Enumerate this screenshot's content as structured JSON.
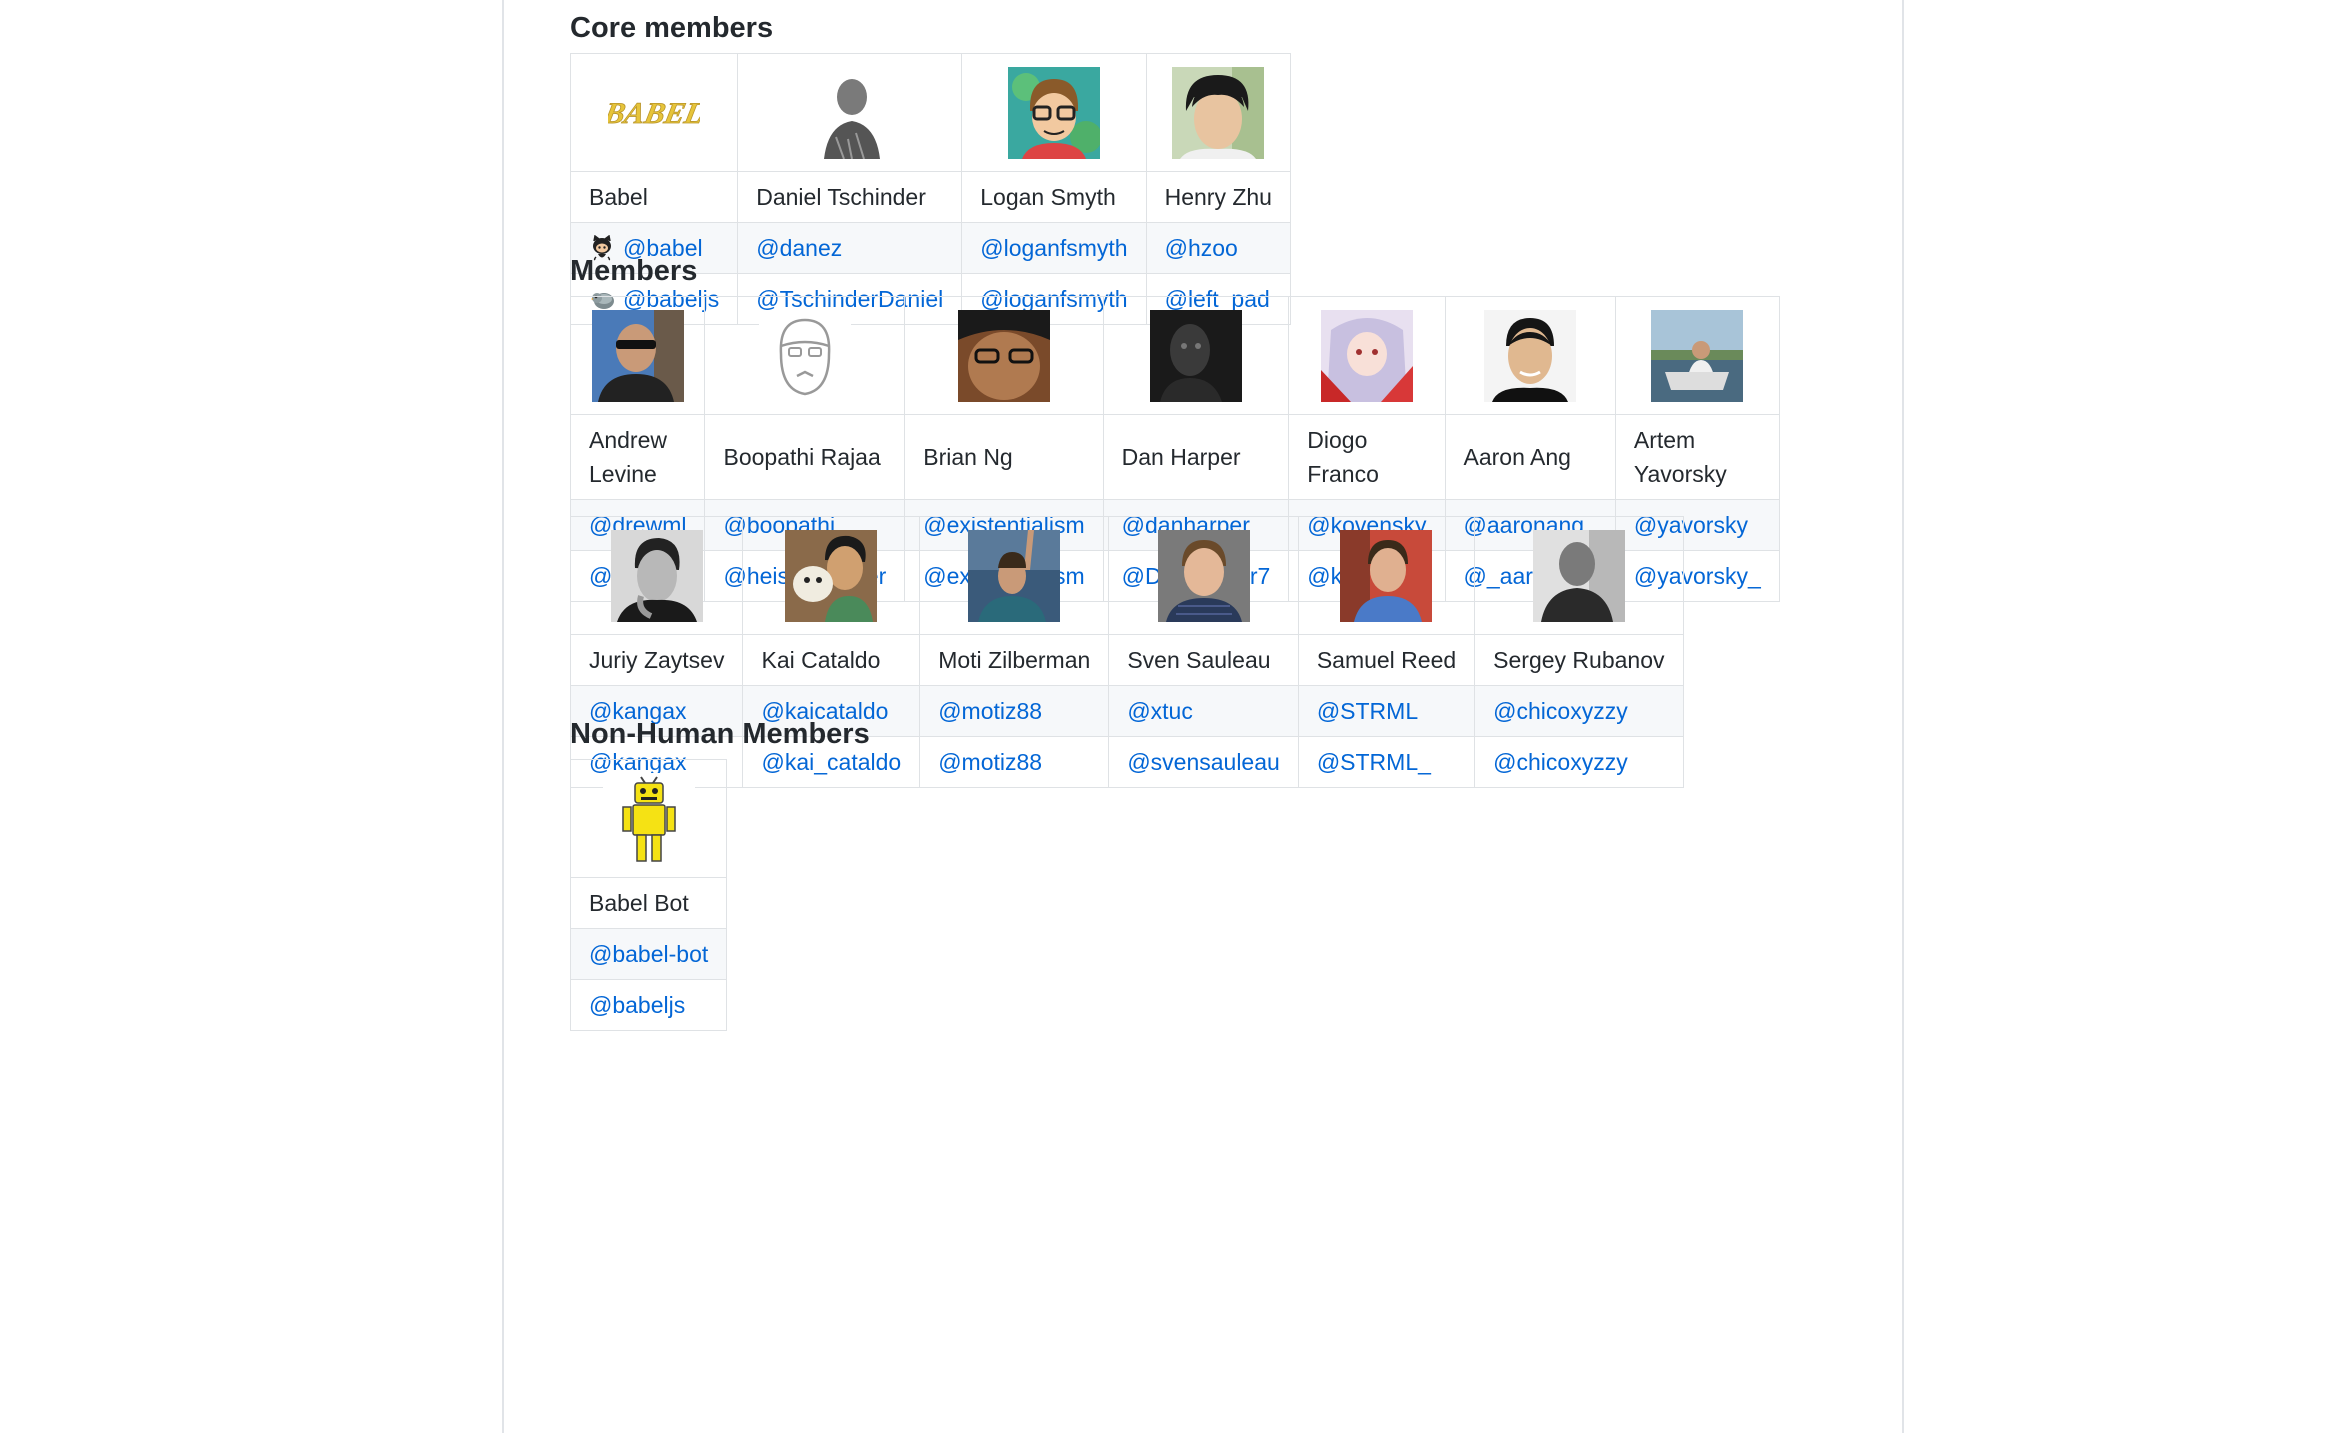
{
  "sections": {
    "core_title": "Core members",
    "members_title": "Members",
    "nonhuman_title": "Non-Human Members"
  },
  "core": [
    {
      "name": "Babel",
      "github": "@babel",
      "twitter": "@babeljs",
      "avatar": "babel-logo"
    },
    {
      "name": "Daniel Tschinder",
      "github": "@danez",
      "twitter": "@TschinderDaniel",
      "avatar": "photo"
    },
    {
      "name": "Logan Smyth",
      "github": "@loganfsmyth",
      "twitter": "@loganfsmyth",
      "avatar": "cartoon"
    },
    {
      "name": "Henry Zhu",
      "github": "@hzoo",
      "twitter": "@left_pad",
      "avatar": "photo"
    }
  ],
  "members_row1": [
    {
      "name": "Andrew Levine",
      "github": "@drewml",
      "twitter": "@drewml"
    },
    {
      "name": "Boopathi Rajaa",
      "github": "@boopathi",
      "twitter": "@heisenbugger"
    },
    {
      "name": "Brian Ng",
      "github": "@existentialism",
      "twitter": "@existentialism"
    },
    {
      "name": "Dan Harper",
      "github": "@danharper",
      "twitter": "@DanHarper7"
    },
    {
      "name": "Diogo Franco",
      "github": "@kovensky",
      "twitter": "@kovnsk"
    },
    {
      "name": "Aaron Ang",
      "github": "@aaronang",
      "twitter": "@_aaronang"
    },
    {
      "name": "Artem Yavorsky",
      "github": "@yavorsky",
      "twitter": "@yavorsky_"
    }
  ],
  "members_row2": [
    {
      "name": "Juriy Zaytsev",
      "github": "@kangax",
      "twitter": "@kangax"
    },
    {
      "name": "Kai Cataldo",
      "github": "@kaicataldo",
      "twitter": "@kai_cataldo"
    },
    {
      "name": "Moti Zilberman",
      "github": "@motiz88",
      "twitter": "@motiz88"
    },
    {
      "name": "Sven Sauleau",
      "github": "@xtuc",
      "twitter": "@svensauleau"
    },
    {
      "name": "Samuel Reed",
      "github": "@STRML",
      "twitter": "@STRML_"
    },
    {
      "name": "Sergey Rubanov",
      "github": "@chicoxyzzy",
      "twitter": "@chicoxyzzy"
    }
  ],
  "nonhuman": [
    {
      "name": "Babel Bot",
      "github": "@babel-bot",
      "twitter": "@babeljs"
    }
  ],
  "babel_logo_text": "BABEL",
  "icons": {
    "github": "github-octocat-icon",
    "twitter": "twitter-bird-icon"
  },
  "colors": {
    "link": "#0366d6",
    "border": "#dfe2e5",
    "alt_row": "#f6f8fa",
    "logo": "#e6c43a",
    "robot": "#f5e214"
  }
}
